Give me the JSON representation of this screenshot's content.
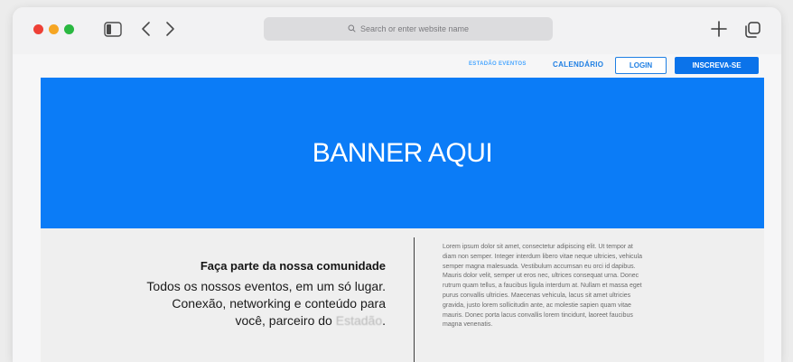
{
  "browser": {
    "address_placeholder": "Search or enter website name",
    "icons": [
      "sidebar-icon",
      "back-icon",
      "forward-icon",
      "search-icon",
      "new-tab-icon",
      "tabs-overview-icon"
    ]
  },
  "nav": {
    "eventos": "ESTADÃO EVENTOS",
    "calendario": "CALENDÁRIO",
    "login": "LOGIN",
    "inscreva": "INSCREVA-SE"
  },
  "banner": {
    "text": "BANNER AQUI",
    "color": "#0b7cf7"
  },
  "community": {
    "title": "Faça parte da nossa comunidade",
    "line1": "Todos os nossos eventos, em um só lugar.",
    "line2": "Conexão, networking e conteúdo para",
    "line3_prefix": "você, parceiro do ",
    "brand": "Estadão",
    "line3_suffix": "."
  },
  "lorem": "Lorem ipsum dolor sit amet, consectetur adipiscing elit. Ut tempor at diam non semper. Integer interdum libero vitae neque ultricies, vehicula semper magna malesuada. Vestibulum accumsan eu orci id dapibus. Mauris dolor velit, semper ut eros nec, ultrices consequat urna. Donec rutrum quam tellus, a faucibus ligula interdum at. Nullam et massa eget purus convallis ultricies. Maecenas vehicula, lacus sit amet ultricies gravida, justo lorem sollicitudin ante, ac molestie sapien quam vitae mauris. Donec porta lacus convallis lorem tincidunt, laoreet faucibus magna venenatis.",
  "colors": {
    "accent": "#0b73ea",
    "link": "#1f7fe3"
  }
}
